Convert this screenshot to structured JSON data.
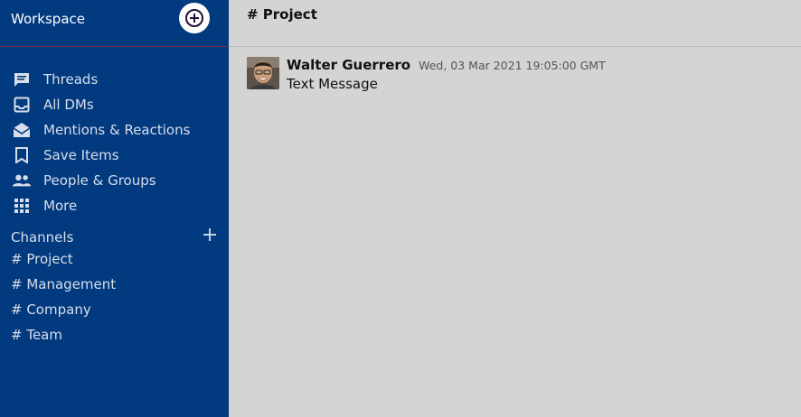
{
  "sidebar": {
    "workspace_title": "Workspace",
    "nav": [
      {
        "label": "Threads",
        "icon": "threads-icon"
      },
      {
        "label": "All DMs",
        "icon": "inbox-icon"
      },
      {
        "label": "Mentions & Reactions",
        "icon": "envelope-open-icon"
      },
      {
        "label": "Save Items",
        "icon": "bookmark-icon"
      },
      {
        "label": "People & Groups",
        "icon": "people-icon"
      },
      {
        "label": "More",
        "icon": "grid-icon"
      }
    ],
    "channels_label": "Channels",
    "channels": [
      "# Project",
      "# Management",
      "# Company",
      "# Team"
    ]
  },
  "main": {
    "channel_title": "# Project",
    "messages": [
      {
        "author": "Walter Guerrero",
        "timestamp": "Wed, 03 Mar 2021 19:05:00 GMT",
        "text": "Text Message"
      }
    ]
  },
  "colors": {
    "sidebar_bg": "#023a80",
    "main_bg": "#d4d4d4",
    "accent_text": "#ffffff"
  }
}
